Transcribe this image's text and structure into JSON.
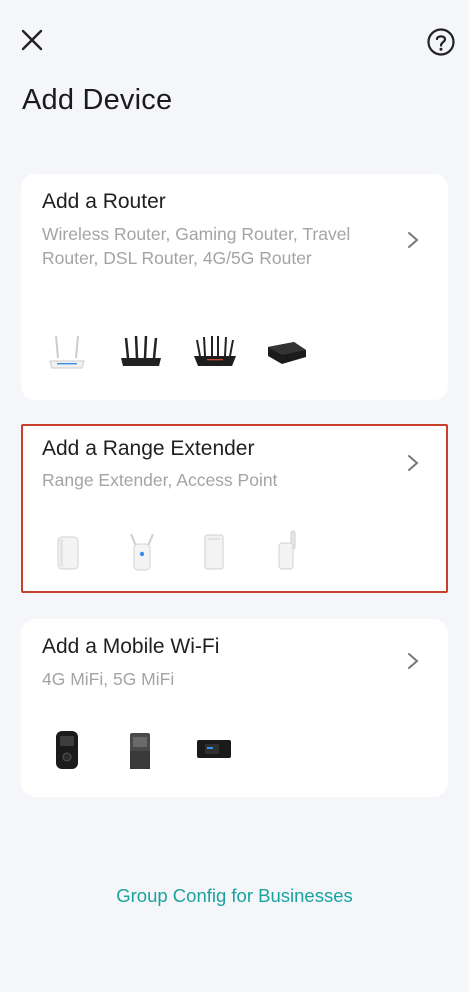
{
  "header": {
    "close_icon": "close-icon",
    "help_icon": "help-circle-icon"
  },
  "page": {
    "title": "Add Device"
  },
  "cards": [
    {
      "title": "Add a Router",
      "subtitle": "Wireless Router, Gaming Router, Travel Router, DSL Router, 4G/5G Router",
      "devices": [
        "wireless-router-icon",
        "router-ax-icon",
        "gaming-router-icon",
        "travel-router-icon"
      ]
    },
    {
      "title": "Add a Range Extender",
      "subtitle": "Range Extender, Access Point",
      "devices": [
        "wall-extender-icon",
        "antenna-extender-icon",
        "mesh-extender-icon",
        "dual-antenna-extender-icon"
      ]
    },
    {
      "title": "Add a Mobile Wi-Fi",
      "subtitle": "4G MiFi, 5G MiFi",
      "devices": [
        "mifi-4g-icon",
        "mifi-5g-icon",
        "mifi-pocket-icon"
      ]
    }
  ],
  "footer": {
    "link": "Group Config for Businesses"
  },
  "colors": {
    "accent": "#1aa39e",
    "highlight": "#c9402a",
    "background": "#f4f6fa"
  }
}
